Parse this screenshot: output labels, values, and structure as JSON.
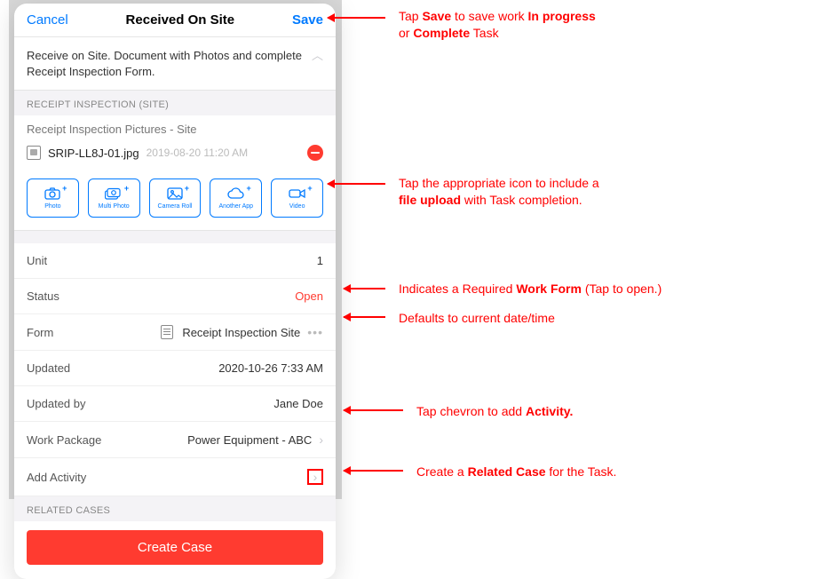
{
  "header": {
    "cancel": "Cancel",
    "title": "Received On Site",
    "save": "Save"
  },
  "description": "Receive on Site.  Document with Photos and complete Receipt Inspection Form.",
  "sections": {
    "receiptInspection": "Receipt Inspection (Site)",
    "picturesTitle": "Receipt Inspection Pictures - Site",
    "relatedCases": "Related Cases"
  },
  "file": {
    "name": "SRIP-LL8J-01.jpg",
    "date": "2019-08-20 11:20 AM"
  },
  "uploadButtons": [
    {
      "icon": "camera",
      "label": "Photo"
    },
    {
      "icon": "multi",
      "label": "Multi Photo"
    },
    {
      "icon": "roll",
      "label": "Camera Roll"
    },
    {
      "icon": "cloud",
      "label": "Another App"
    },
    {
      "icon": "video",
      "label": "Video"
    }
  ],
  "details": {
    "unitLabel": "Unit",
    "unitValue": "1",
    "statusLabel": "Status",
    "statusValue": "Open",
    "formLabel": "Form",
    "formValue": "Receipt Inspection Site",
    "updatedLabel": "Updated",
    "updatedValue": "2020-10-26 7:33 AM",
    "updatedByLabel": "Updated by",
    "updatedByValue": "Jane Doe",
    "workPackageLabel": "Work Package",
    "workPackageValue": "Power Equipment - ABC",
    "addActivityLabel": "Add Activity"
  },
  "createCase": "Create Case",
  "annotations": {
    "save1": "Tap ",
    "save2": "Save",
    "save3": " to save work ",
    "save4": "In progress",
    "save5": "or ",
    "save6": "Complete",
    "save7": " Task",
    "upload1": "Tap the appropriate icon to include a",
    "upload2": "file upload",
    "upload3": " with Task completion.",
    "form1": "Indicates a Required ",
    "form2": "Work Form",
    "form3": " (Tap to open.)",
    "updated": "Defaults to current date/time",
    "activity1": "Tap chevron to add ",
    "activity2": "Activity.",
    "case1": "Create a ",
    "case2": "Related Case",
    "case3": " for the Task."
  }
}
